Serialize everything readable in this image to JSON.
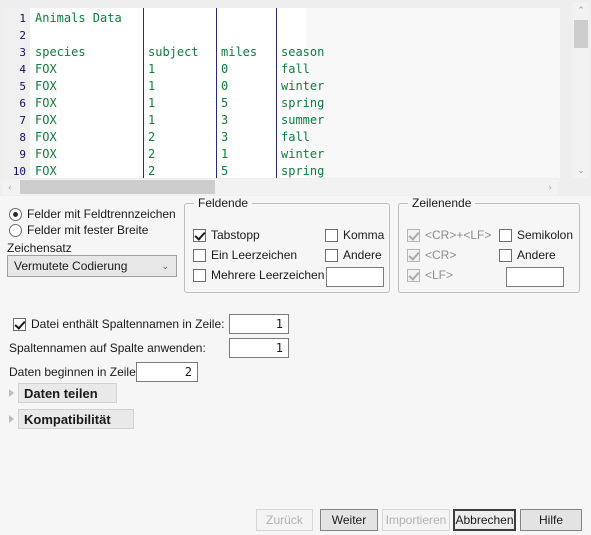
{
  "preview": {
    "line_numbers": [
      "1",
      "2",
      "3",
      "4",
      "5",
      "6",
      "7",
      "8",
      "9",
      "10"
    ],
    "columns": [
      "species",
      "subject",
      "miles",
      "season"
    ],
    "rows": [
      [
        "Animals Data",
        "",
        "",
        ""
      ],
      [
        "",
        "",
        "",
        ""
      ],
      [
        "species",
        "subject",
        "miles",
        "season"
      ],
      [
        "FOX",
        "1",
        "0",
        "fall"
      ],
      [
        "FOX",
        "1",
        "0",
        "winter"
      ],
      [
        "FOX",
        "1",
        "5",
        "spring"
      ],
      [
        "FOX",
        "1",
        "3",
        "summer"
      ],
      [
        "FOX",
        "2",
        "3",
        "fall"
      ],
      [
        "FOX",
        "2",
        "1",
        "winter"
      ],
      [
        "FOX",
        "2",
        "5",
        "spring"
      ]
    ],
    "text_color": "#117a3d",
    "line_number_color": "#101060",
    "separator_color": "#2a2a7a"
  },
  "mode": {
    "delimited_label": "Felder mit Feldtrennzeichen",
    "delimited_selected": true,
    "fixed_width_label": "Felder mit fester Breite",
    "fixed_width_selected": false
  },
  "charset": {
    "label": "Zeichensatz",
    "value": "Vermutete Codierung",
    "options": [
      "Vermutete Codierung"
    ]
  },
  "field_end": {
    "title": "Feldende",
    "items": [
      {
        "label": "Tabstopp",
        "checked": true,
        "disabled": false
      },
      {
        "label": "Ein Leerzeichen",
        "checked": false,
        "disabled": false
      },
      {
        "label": "Mehrere Leerzeichen",
        "checked": false,
        "disabled": false
      },
      {
        "label": "Komma",
        "checked": false,
        "disabled": false
      },
      {
        "label": "Andere",
        "checked": false,
        "disabled": false
      }
    ],
    "other_value": ""
  },
  "line_end": {
    "title": "Zeilenende",
    "items": [
      {
        "label": "<CR>+<LF>",
        "checked": true,
        "disabled": true
      },
      {
        "label": "<CR>",
        "checked": true,
        "disabled": true
      },
      {
        "label": "<LF>",
        "checked": true,
        "disabled": true
      },
      {
        "label": "Semikolon",
        "checked": false,
        "disabled": false
      },
      {
        "label": "Andere",
        "checked": false,
        "disabled": false
      }
    ],
    "other_value": ""
  },
  "columns_options": {
    "has_column_names_label": "Datei enthält Spaltennamen in Zeile:",
    "has_column_names_checked": true,
    "has_column_names_value": "1",
    "apply_names_label": "Spaltennamen auf Spalte anwenden:",
    "apply_names_value": "1",
    "data_start_label": "Daten beginnen in Zeile:",
    "data_start_value": "2"
  },
  "sections": [
    {
      "label": "Daten teilen",
      "expanded": false
    },
    {
      "label": "Kompatibilität",
      "expanded": false
    }
  ],
  "buttons": [
    {
      "label": "Zurück",
      "disabled": true,
      "default": false
    },
    {
      "label": "Weiter",
      "disabled": false,
      "default": false
    },
    {
      "label": "Importieren",
      "disabled": true,
      "default": false
    },
    {
      "label": "Abbrechen",
      "disabled": false,
      "default": true
    },
    {
      "label": "Hilfe",
      "disabled": false,
      "default": false
    }
  ],
  "icons": {
    "scroll_up": "⌃",
    "scroll_down": "⌄",
    "scroll_left": "‹",
    "scroll_right": "›",
    "combo_chevron": "⌄"
  }
}
